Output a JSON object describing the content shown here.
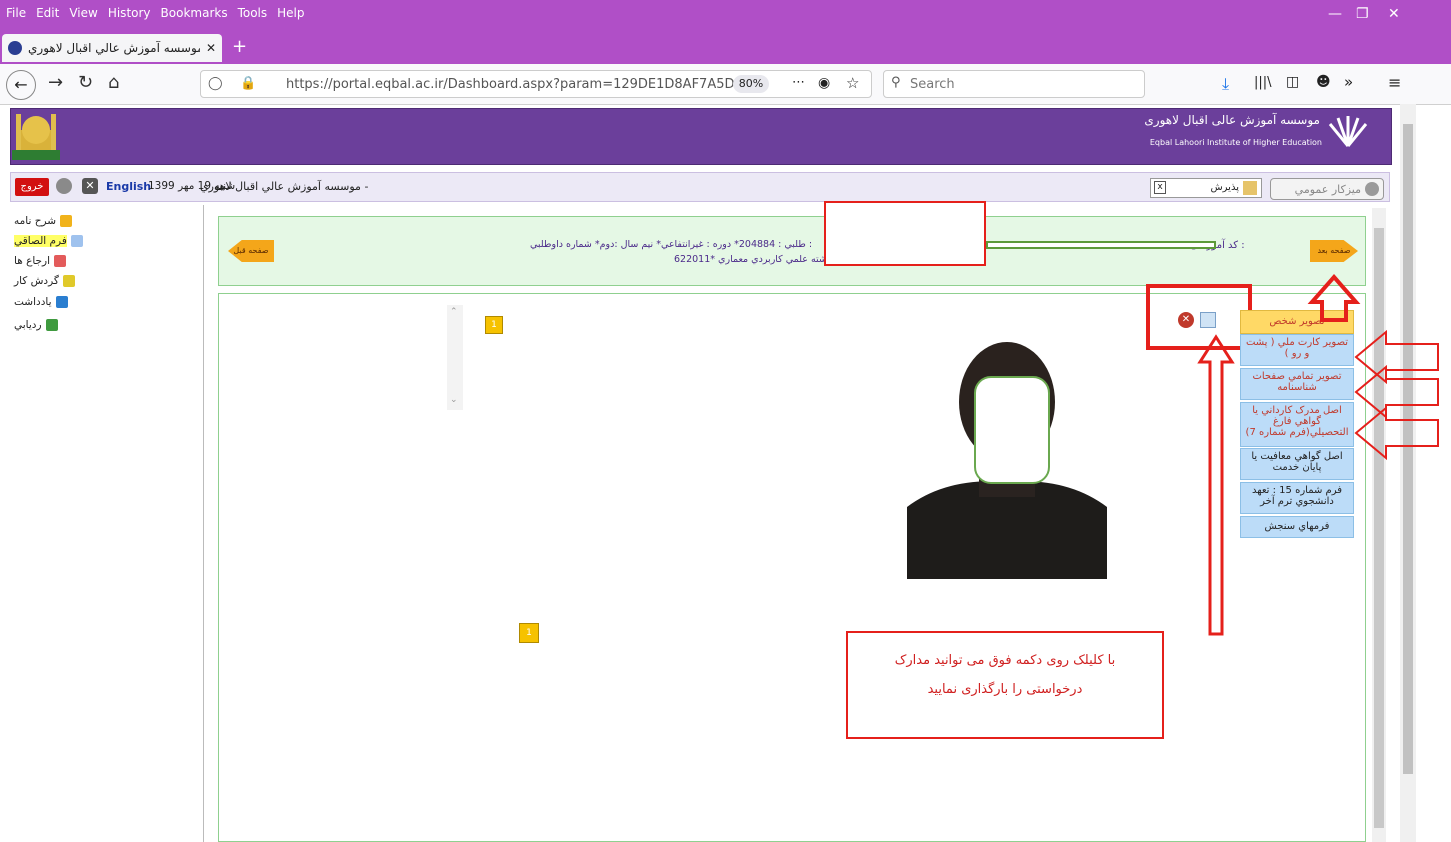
{
  "browser": {
    "menu": [
      "File",
      "Edit",
      "View",
      "History",
      "Bookmarks",
      "Tools",
      "Help"
    ],
    "tab_title": "موسسه آموزش عالي اقبال لاهوري",
    "tab_close": "✕",
    "new_tab": "+",
    "url": "https://portal.eqbal.ac.ir/Dashboard.aspx?param=129DE1D8AF7A5DA1A",
    "zoom": "80%",
    "search_placeholder": "Search",
    "window_controls": [
      "—",
      "❐",
      "✕"
    ]
  },
  "site": {
    "logo_title": "موسسه آموزش عالی اقبال لاهوری",
    "logo_subtitle": "Eqbal Lahoori Institute of Higher Education",
    "logout": "خروج",
    "english": "English",
    "date_text": "1399 شنبه 19 مهر",
    "site_name": "موسسه آموزش عالي اقبال لاهوري -",
    "receive_label": "پذيرش",
    "desk_label": "ميزكار عمومي"
  },
  "left_nav": {
    "items": [
      {
        "label": "شرح نامه",
        "color": "#f1b31b"
      },
      {
        "label": "فرم الصاقي",
        "color": "#9fc2ee",
        "highlighted": true
      },
      {
        "label": "ارجاع ها",
        "color": "#e35b5b"
      },
      {
        "label": "گردش کار",
        "color": "#e0c92a"
      },
      {
        "label": "يادداشت",
        "color": "#2a7ed0"
      },
      {
        "label": "رديابي",
        "color": "#3f9a3f"
      }
    ]
  },
  "info": {
    "prev_page": "صفحه قبل",
    "next_page": "صفحه بعد",
    "code_label": "*کد آموزشی :",
    "line1": "طلبي : 204884* دوره : غيرانتفاعي* نيم سال :دوم* شماره داوطلبي :",
    "line2": "622011* و شماره پرونده : 204884* وسته رشته علمي کاربردي معماري"
  },
  "documents": {
    "items": [
      {
        "label": "تصوير شخص",
        "color": "#ffd966",
        "text_color": "#c0392b"
      },
      {
        "label": "تصوير کارت ملي ( پشت و رو )",
        "color": "#bcdcf8",
        "text_color": "#c0392b"
      },
      {
        "label": "تصوير تمامي صفحات شناسنامه",
        "color": "#bcdcf8",
        "text_color": "#c0392b"
      },
      {
        "label": "اصل مدرک کارداني يا گواهي فارغ التحصيلي(فرم شماره 7)",
        "color": "#bcdcf8",
        "text_color": "#c0392b"
      },
      {
        "label": "اصل گواهي معافيت يا پايان خدمت",
        "color": "#bcdcf8",
        "text_color": "#222222"
      },
      {
        "label": "فرم شماره 15 : تعهد دانشجوي ترم آخر",
        "color": "#bcdcf8",
        "text_color": "#222222"
      },
      {
        "label": "فرمهاي سنجش",
        "color": "#bcdcf8",
        "text_color": "#222222"
      }
    ],
    "page_badge_1": "1",
    "page_badge_2": "1"
  },
  "callout": {
    "line1": "با کلیلک روی دکمه فوق می توانید مدارک",
    "line2": "درخواستی را بارگذاری نمایید"
  }
}
